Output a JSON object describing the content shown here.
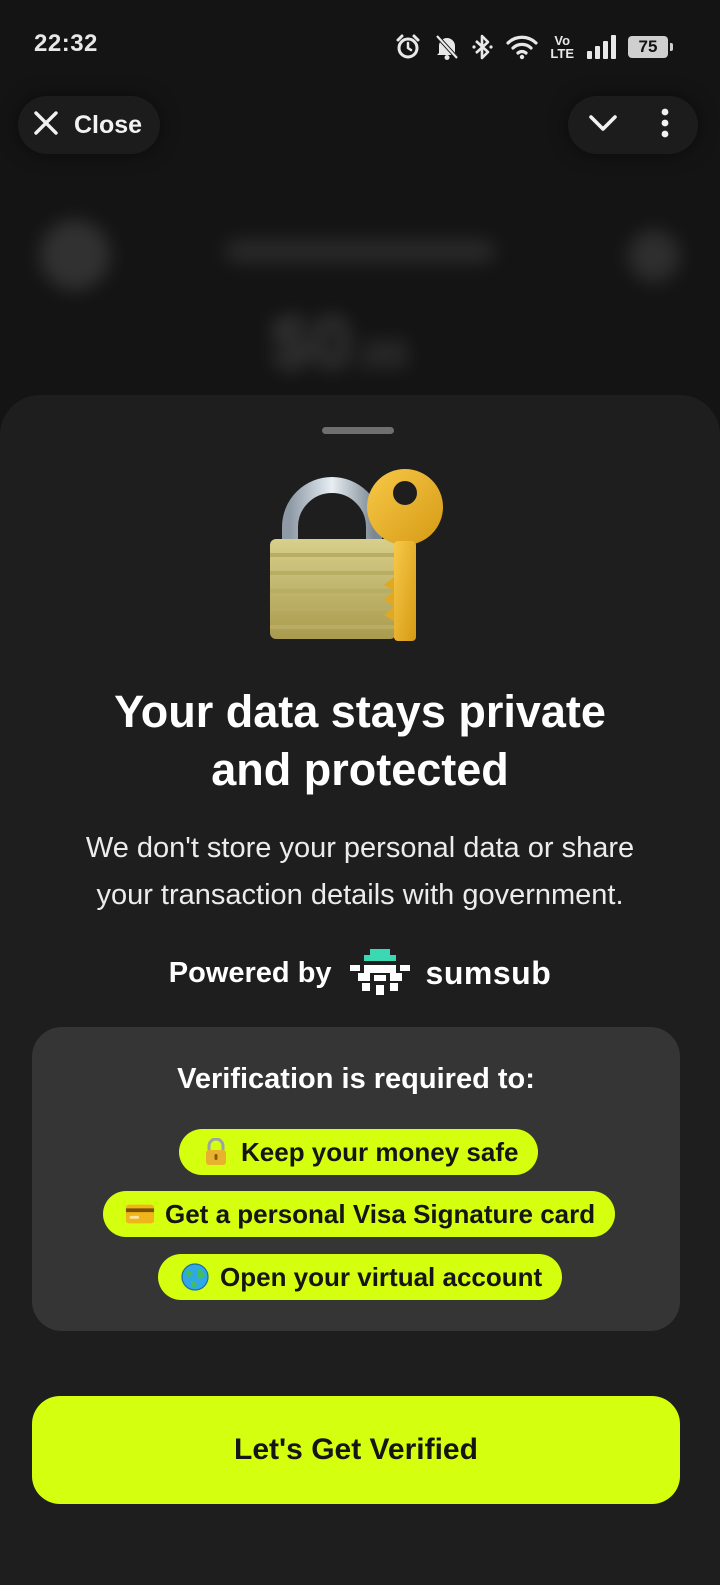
{
  "status_bar": {
    "time": "22:32",
    "battery": "75",
    "icons": [
      "alarm-icon",
      "muted-bell-icon",
      "bluetooth-icon",
      "wifi-icon",
      "volte-icon",
      "signal-icon",
      "battery-icon"
    ],
    "volte_top": "Vo",
    "volte_bottom": "LTE"
  },
  "top_bar": {
    "close_label": "Close",
    "icons": [
      "close-icon",
      "chevron-down-icon",
      "more-vertical-icon"
    ]
  },
  "sheet": {
    "hero_icon": "lock-with-key-icon",
    "headline_line1": "Your data stays private",
    "headline_line2": "and protected",
    "subtext_line1": "We don't store your personal data or share",
    "subtext_line2": "your transaction details with government.",
    "powered_by": "Powered by",
    "brand": "sumsub",
    "requirements": {
      "title": "Verification is required to:",
      "items": [
        {
          "icon": "lock-icon",
          "label": "Keep your money safe"
        },
        {
          "icon": "credit-card-icon",
          "label": "Get a personal Visa Signature card"
        },
        {
          "icon": "globe-icon",
          "label": "Open your virtual account"
        }
      ]
    },
    "cta_label": "Let's Get Verified"
  },
  "colors": {
    "accent": "#d4ff0f",
    "sheet_bg": "#1e1e1e",
    "card_bg": "#353535",
    "sumsub_teal": "#3ad8b3"
  }
}
